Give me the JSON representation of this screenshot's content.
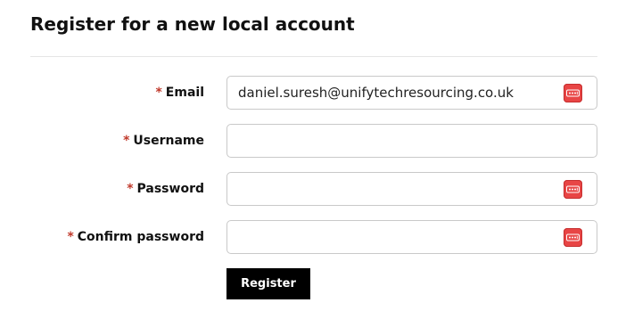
{
  "page": {
    "title": "Register for a new local account"
  },
  "form": {
    "required_marker": "*",
    "fields": [
      {
        "label": "Email",
        "value": "daniel.suresh@unifytechresourcing.co.uk",
        "placeholder": "",
        "type": "email",
        "password_manager_icon": true
      },
      {
        "label": "Username",
        "value": "",
        "placeholder": "",
        "type": "text",
        "password_manager_icon": false
      },
      {
        "label": "Password",
        "value": "",
        "placeholder": "",
        "type": "password",
        "password_manager_icon": true
      },
      {
        "label": "Confirm password",
        "value": "",
        "placeholder": "",
        "type": "password",
        "password_manager_icon": true
      }
    ],
    "submit_label": "Register"
  },
  "colors": {
    "required_marker": "#c0392b",
    "button_background": "#000000",
    "button_text": "#ffffff",
    "password_manager_icon": "#e84545"
  },
  "icons": {
    "password_manager": "password-manager-icon"
  }
}
